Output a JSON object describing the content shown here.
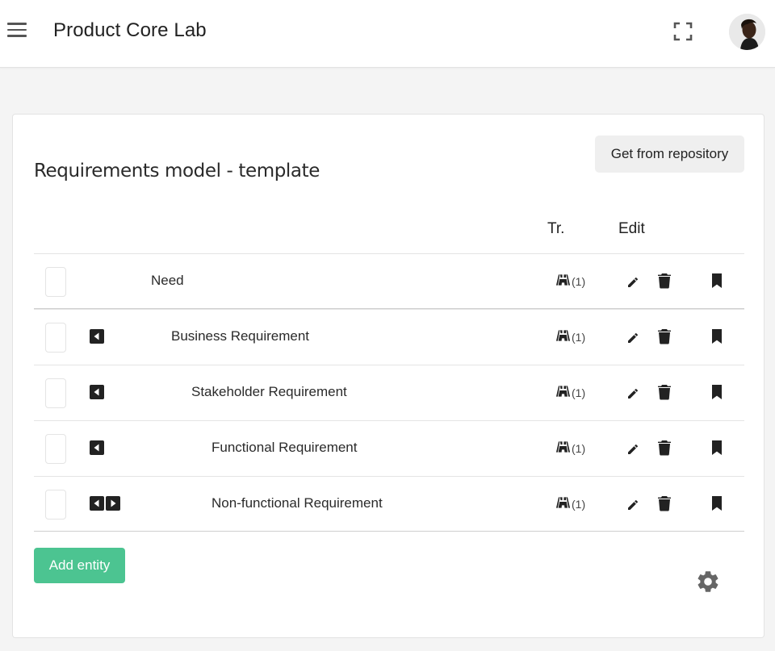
{
  "app": {
    "title": "Product Core Lab"
  },
  "icons": {
    "menu": "hamburger-icon",
    "fullscreen": "fullscreen-icon",
    "avatar": "user-avatar",
    "edit": "pencil-icon",
    "delete": "trash-icon",
    "bookmark": "bookmark-icon",
    "trace": "road-icon",
    "settings": "gear-icon"
  },
  "card": {
    "title": "Requirements model - template",
    "repo_button": "Get from repository",
    "columns": {
      "tr": "Tr.",
      "edit": "Edit"
    },
    "add_button": "Add entity"
  },
  "rows": [
    {
      "label": "Need",
      "trace": "(1)",
      "arrows": []
    },
    {
      "label": "Business Requirement",
      "trace": "(1)",
      "arrows": [
        "left"
      ]
    },
    {
      "label": "Stakeholder Requirement",
      "trace": "(1)",
      "arrows": [
        "left"
      ]
    },
    {
      "label": "Functional Requirement",
      "trace": "(1)",
      "arrows": [
        "left"
      ]
    },
    {
      "label": "Non-functional Requirement",
      "trace": "(1)",
      "arrows": [
        "left",
        "right"
      ]
    }
  ],
  "colors": {
    "accent": "#4cc491",
    "icon": "#222222"
  }
}
